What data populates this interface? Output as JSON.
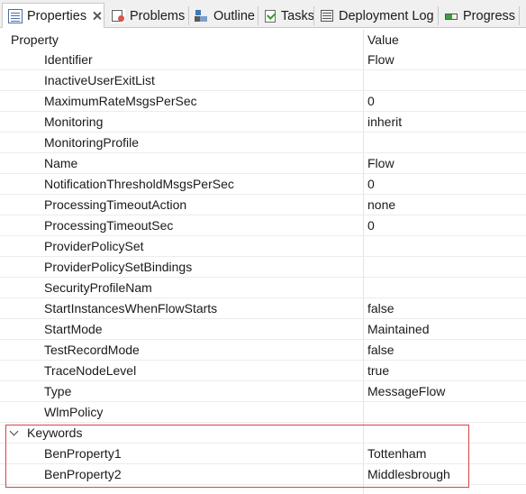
{
  "tabs": [
    {
      "label": "Properties",
      "icon": "properties-icon",
      "active": true
    },
    {
      "label": "Problems",
      "icon": "problems-icon"
    },
    {
      "label": "Outline",
      "icon": "outline-icon"
    },
    {
      "label": "Tasks",
      "icon": "tasks-icon"
    },
    {
      "label": "Deployment Log",
      "icon": "deployment-log-icon"
    },
    {
      "label": "Progress",
      "icon": "progress-icon"
    }
  ],
  "table": {
    "headers": {
      "property": "Property",
      "value": "Value"
    },
    "rows": [
      {
        "key": "Identifier",
        "value": "Flow"
      },
      {
        "key": "InactiveUserExitList",
        "value": ""
      },
      {
        "key": "MaximumRateMsgsPerSec",
        "value": "0"
      },
      {
        "key": "Monitoring",
        "value": "inherit"
      },
      {
        "key": "MonitoringProfile",
        "value": ""
      },
      {
        "key": "Name",
        "value": "Flow"
      },
      {
        "key": "NotificationThresholdMsgsPerSec",
        "value": "0"
      },
      {
        "key": "ProcessingTimeoutAction",
        "value": "none"
      },
      {
        "key": "ProcessingTimeoutSec",
        "value": "0"
      },
      {
        "key": "ProviderPolicySet",
        "value": ""
      },
      {
        "key": "ProviderPolicySetBindings",
        "value": ""
      },
      {
        "key": "SecurityProfileNam",
        "value": ""
      },
      {
        "key": "StartInstancesWhenFlowStarts",
        "value": "false"
      },
      {
        "key": "StartMode",
        "value": "Maintained"
      },
      {
        "key": "TestRecordMode",
        "value": "false"
      },
      {
        "key": "TraceNodeLevel",
        "value": "true"
      },
      {
        "key": "Type",
        "value": "MessageFlow"
      },
      {
        "key": "WlmPolicy",
        "value": ""
      }
    ],
    "group": {
      "label": "Keywords",
      "rows": [
        {
          "key": "BenProperty1",
          "value": "Tottenham"
        },
        {
          "key": "BenProperty2",
          "value": "Middlesbrough"
        }
      ]
    }
  },
  "colors": {
    "highlight_border": "#d64545",
    "tabbar_bg": "#f0f0f0"
  }
}
